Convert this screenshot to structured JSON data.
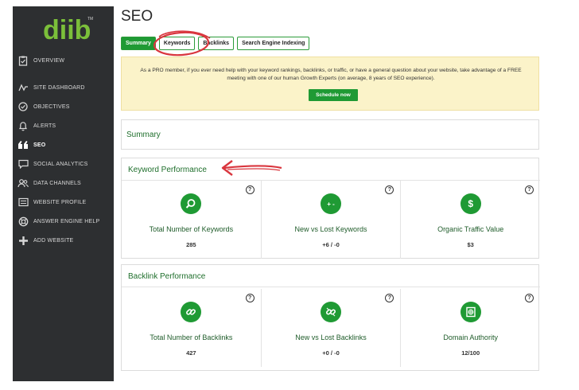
{
  "brand": {
    "logo_text": "diib",
    "trademark": "TM",
    "accent": "#1f9a34",
    "sidebar_bg": "#2d2f31"
  },
  "sidebar": {
    "items": [
      {
        "label": "OVERVIEW",
        "icon": "clipboard-icon"
      },
      {
        "label": "SITE DASHBOARD",
        "icon": "pulse-icon"
      },
      {
        "label": "OBJECTIVES",
        "icon": "check-circle-icon"
      },
      {
        "label": "ALERTS",
        "icon": "bell-icon"
      },
      {
        "label": "SEO",
        "icon": "quote-icon",
        "active": true
      },
      {
        "label": "SOCIAL ANALYTICS",
        "icon": "chat-icon"
      },
      {
        "label": "DATA CHANNELS",
        "icon": "users-icon"
      },
      {
        "label": "WEBSITE PROFILE",
        "icon": "list-icon"
      },
      {
        "label": "ANSWER ENGINE HELP",
        "icon": "lifebuoy-icon"
      },
      {
        "label": "ADD WEBSITE",
        "icon": "plus-icon"
      }
    ]
  },
  "header": {
    "title": "SEO"
  },
  "tabs": [
    {
      "label": "Summary",
      "active": true
    },
    {
      "label": "Keywords"
    },
    {
      "label": "Backlinks"
    },
    {
      "label": "Search Engine Indexing"
    }
  ],
  "notice": {
    "text": "As a PRO member, if you ever need help with your keyword rankings, backlinks, or traffic, or have a general question about your website, take advantage of a FREE meeting with one of our human Growth Experts (on average, 8 years of SEO experience).",
    "button": "Schedule now",
    "bg": "#fbf3c9"
  },
  "summary": {
    "heading": "Summary"
  },
  "keyword_performance": {
    "heading": "Keyword Performance",
    "metrics": [
      {
        "label": "Total Number of Keywords",
        "value": "285",
        "icon": "search-icon",
        "help": "?"
      },
      {
        "label": "New vs Lost Keywords",
        "value": "+6 / -0",
        "icon": "plus-minus-icon",
        "icon_text": "+ -",
        "help": "?"
      },
      {
        "label": "Organic Traffic Value",
        "value": "$3",
        "icon": "dollar-icon",
        "icon_text": "$",
        "help": "?"
      }
    ]
  },
  "backlink_performance": {
    "heading": "Backlink Performance",
    "metrics": [
      {
        "label": "Total Number of Backlinks",
        "value": "427",
        "icon": "link-icon",
        "help": "?"
      },
      {
        "label": "New vs Lost Backlinks",
        "value": "+0 / -0",
        "icon": "broken-link-icon",
        "help": "?"
      },
      {
        "label": "Domain Authority",
        "value": "12/100",
        "icon": "globe-page-icon",
        "help": "?"
      }
    ]
  },
  "annotation": {
    "color": "#d9363e"
  }
}
